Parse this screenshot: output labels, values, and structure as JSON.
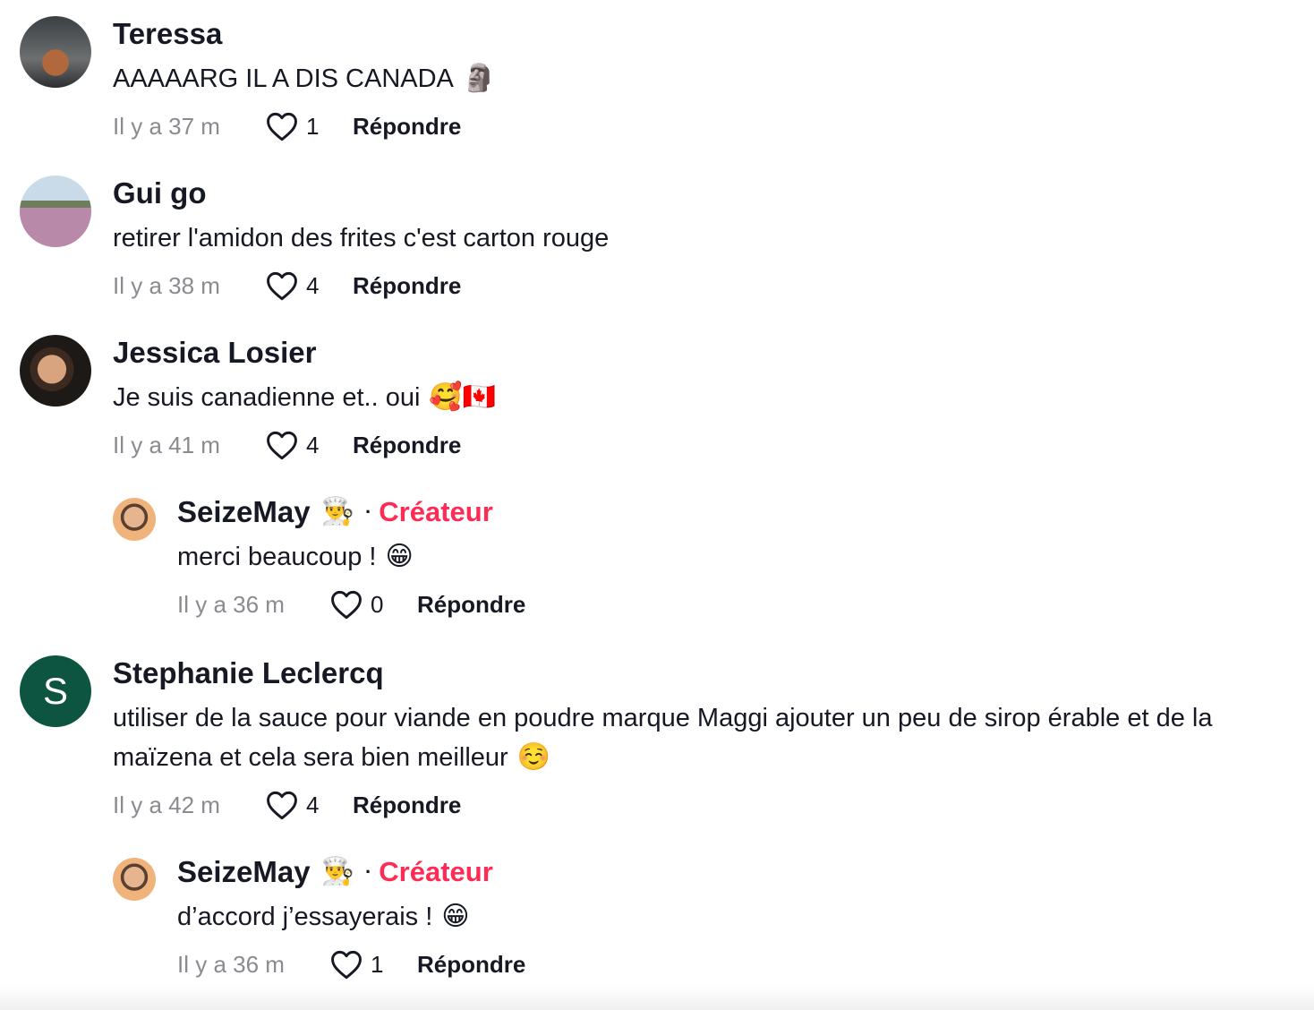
{
  "comments": [
    {
      "username": "Teressa",
      "text": "AAAAARG IL A DIS CANADA",
      "emoji": "🗿",
      "time": "Il y a 37 m",
      "likes": "1",
      "reply_label": "Répondre"
    },
    {
      "username": "Gui go",
      "text": "retirer l'amidon des frites c'est carton rouge",
      "emoji": "",
      "time": "Il y a 38 m",
      "likes": "4",
      "reply_label": "Répondre"
    },
    {
      "username": "Jessica Losier",
      "text": "Je suis canadienne et.. oui",
      "emoji": "🥰🇨🇦",
      "time": "Il y a 41 m",
      "likes": "4",
      "reply_label": "Répondre"
    },
    {
      "username": "SeizeMay",
      "user_emoji": "👨‍🍳",
      "separator": "·",
      "creator_label": "Créateur",
      "text": "merci beaucoup !",
      "emoji": "😁",
      "time": "Il y a 36 m",
      "likes": "0",
      "reply_label": "Répondre"
    },
    {
      "username": "Stephanie Leclercq",
      "avatar_letter": "S",
      "text": "utiliser de la sauce pour viande en poudre marque Maggi ajouter un peu de sirop érable et de la maïzena et cela sera bien meilleur",
      "emoji": "☺️",
      "time": "Il y a 42 m",
      "likes": "4",
      "reply_label": "Répondre"
    },
    {
      "username": "SeizeMay",
      "user_emoji": "👨‍🍳",
      "separator": "·",
      "creator_label": "Créateur",
      "text": "d’accord j’essayerais !",
      "emoji": "😁",
      "time": "Il y a 36 m",
      "likes": "1",
      "reply_label": "Répondre"
    }
  ],
  "colors": {
    "creator": "#fe2c55",
    "meta_gray": "#8a8b91",
    "text": "#161823",
    "avatar_s_bg": "#0d5540"
  },
  "icons": {
    "like": "heart-outline-icon"
  }
}
